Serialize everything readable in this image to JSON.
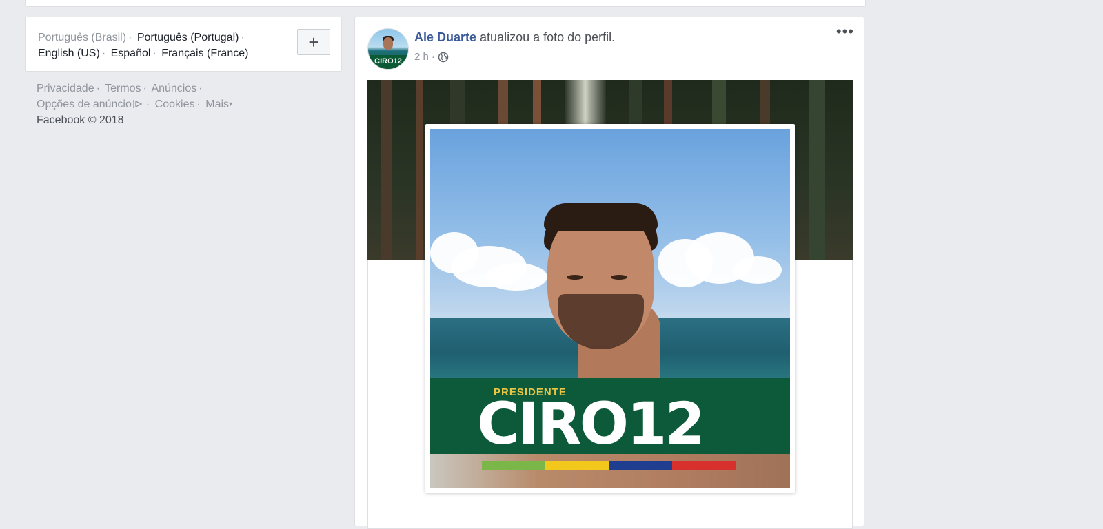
{
  "languages": {
    "current": "Português (Brasil)",
    "others": [
      "Português (Portugal)",
      "English (US)",
      "Español",
      "Français (France)"
    ],
    "add_button": "+"
  },
  "footer": {
    "links": [
      "Privacidade",
      "Termos",
      "Anúncios",
      "Opções de anúncio",
      "Cookies",
      "Mais"
    ],
    "copyright": "Facebook © 2018"
  },
  "post": {
    "author": "Ale Duarte",
    "action": "atualizou a foto do perfil.",
    "time": "2 h",
    "more": "•••",
    "avatar_text": "CIRO12"
  },
  "profile_photo": {
    "banner_small": "PRESIDENTE",
    "banner_big": "CIRO12",
    "stripe_colors": [
      "#7ab648",
      "#f2c81c",
      "#1f3e8f",
      "#d8302d"
    ]
  }
}
